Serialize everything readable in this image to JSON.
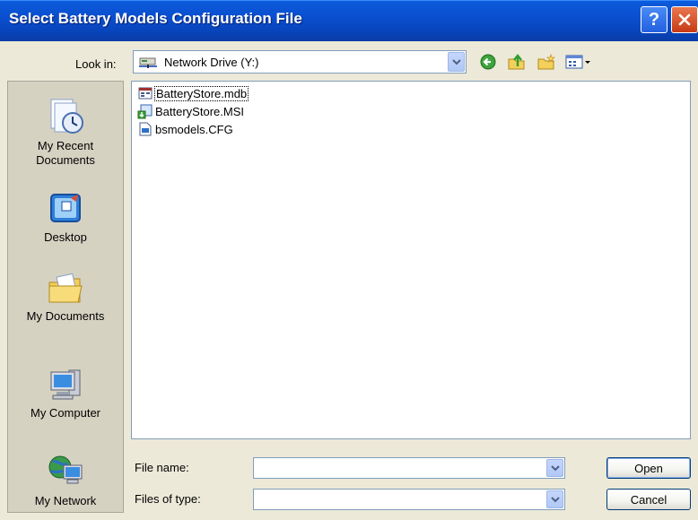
{
  "window": {
    "title": "Select Battery Models Configuration File",
    "help_label": "?",
    "close_label": "✕"
  },
  "lookin": {
    "label": "Look in:",
    "value": "Network Drive (Y:)"
  },
  "toolbar": {
    "icons": [
      "back-icon",
      "up-folder-icon",
      "new-folder-icon",
      "views-menu-icon"
    ]
  },
  "places": [
    {
      "label": "My Recent\nDocuments",
      "icon": "recent-documents-icon"
    },
    {
      "label": "Desktop",
      "icon": "desktop-icon"
    },
    {
      "label": "My Documents",
      "icon": "my-documents-icon"
    },
    {
      "label": "My Computer",
      "icon": "my-computer-icon"
    },
    {
      "label": "My Network",
      "icon": "my-network-icon"
    }
  ],
  "files": [
    {
      "name": "BatteryStore.mdb",
      "icon": "access-database-icon",
      "selected": true
    },
    {
      "name": "BatteryStore.MSI",
      "icon": "installer-icon",
      "selected": false
    },
    {
      "name": "bsmodels.CFG",
      "icon": "config-file-icon",
      "selected": false
    }
  ],
  "filename": {
    "label": "File name:",
    "value": ""
  },
  "filetype": {
    "label": "Files of type:",
    "value": ""
  },
  "buttons": {
    "open": "Open",
    "cancel": "Cancel"
  }
}
